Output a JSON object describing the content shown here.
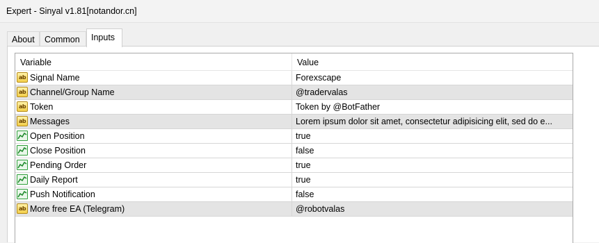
{
  "window": {
    "title": "Expert - Sinyal v1.81[notandor.cn]"
  },
  "tabs": [
    {
      "label": "About",
      "active": false
    },
    {
      "label": "Common",
      "active": false
    },
    {
      "label": "Inputs",
      "active": true
    }
  ],
  "table": {
    "headers": {
      "variable": "Variable",
      "value": "Value"
    },
    "rows": [
      {
        "icon": "string-param-icon",
        "variable": "Signal Name",
        "value": "Forexscape"
      },
      {
        "icon": "string-param-icon",
        "variable": "Channel/Group Name",
        "value": "@tradervalas"
      },
      {
        "icon": "string-param-icon",
        "variable": "Token",
        "value": "Token by @BotFather"
      },
      {
        "icon": "string-param-icon",
        "variable": "Messages",
        "value": "Lorem ipsum dolor sit amet, consectetur adipisicing elit, sed do e..."
      },
      {
        "icon": "bool-param-icon",
        "variable": "Open Position",
        "value": "true"
      },
      {
        "icon": "bool-param-icon",
        "variable": "Close Position",
        "value": "false"
      },
      {
        "icon": "bool-param-icon",
        "variable": "Pending Order",
        "value": "true"
      },
      {
        "icon": "bool-param-icon",
        "variable": "Daily Report",
        "value": "true"
      },
      {
        "icon": "bool-param-icon",
        "variable": "Push Notification",
        "value": "false"
      },
      {
        "icon": "string-param-icon",
        "variable": "More free EA (Telegram)",
        "value": "@robotvalas"
      }
    ]
  },
  "icon_glyphs": {
    "string": "ab"
  },
  "colors": {
    "alt_row": "#e4e4e4",
    "string_icon": "#f3cf4a",
    "bool_icon": "#2f9e3a"
  }
}
